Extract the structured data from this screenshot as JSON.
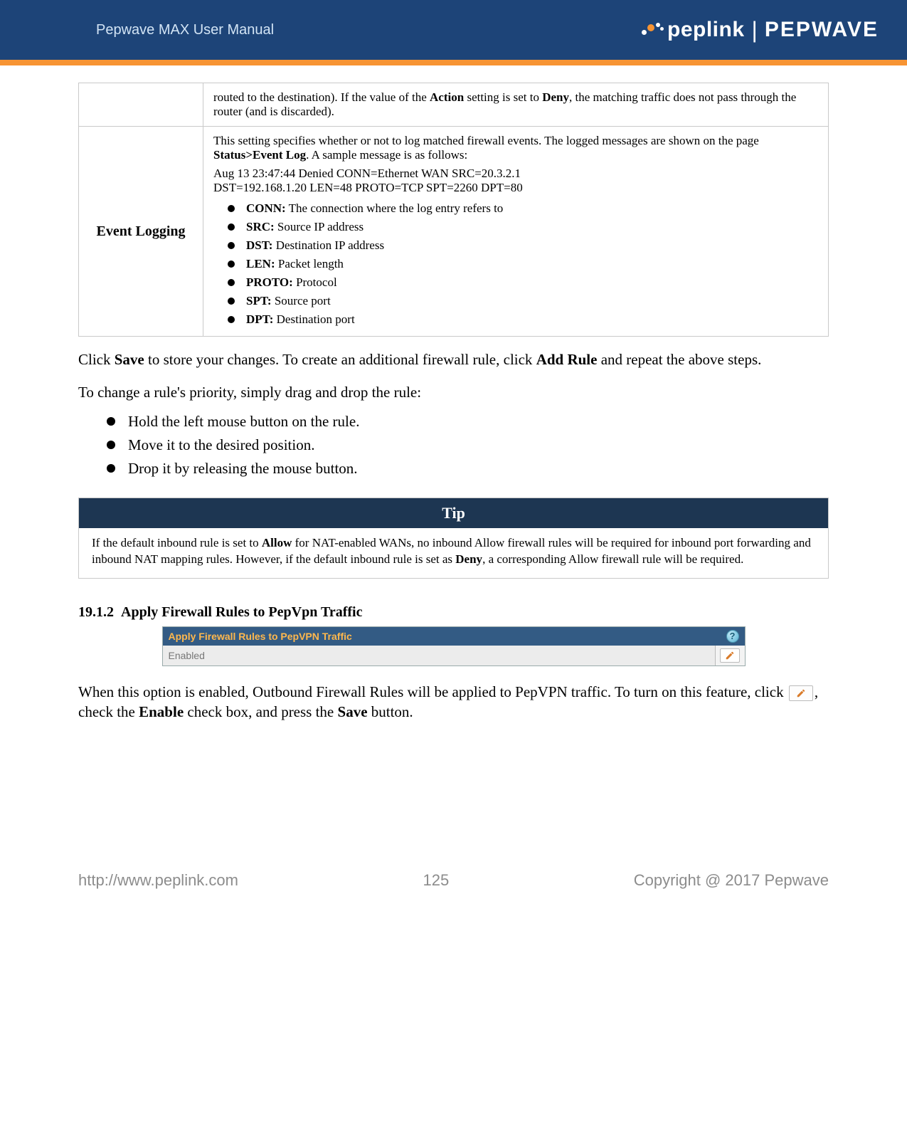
{
  "header": {
    "manual_title": "Pepwave MAX User Manual",
    "brand_left": "peplink",
    "brand_right": "PEPWAVE"
  },
  "table": {
    "row1_text_pre": "routed to the destination). If the value of the ",
    "row1_bold1": "Action",
    "row1_mid": " setting is set to ",
    "row1_bold2": "Deny",
    "row1_text_post": ", the matching traffic does not pass through the router (and is discarded).",
    "row2_label": "Event Logging",
    "row2_p1_pre": "This setting specifies whether or not to log matched firewall events. The logged messages are shown on the page ",
    "row2_p1_bold": "Status>Event Log",
    "row2_p1_post": ". A sample message is as follows:",
    "row2_p2": "Aug 13 23:47:44 Denied CONN=Ethernet WAN SRC=20.3.2.1",
    "row2_p3": "DST=192.168.1.20 LEN=48 PROTO=TCP SPT=2260 DPT=80",
    "defs": [
      {
        "term": "CONN:",
        "desc": "  The connection where the log entry refers to"
      },
      {
        "term": "SRC:",
        "desc": "  Source IP address"
      },
      {
        "term": "DST:",
        "desc": "  Destination IP address"
      },
      {
        "term": "LEN:",
        "desc": "  Packet length"
      },
      {
        "term": "PROTO:",
        "desc": "  Protocol"
      },
      {
        "term": "SPT:",
        "desc": "  Source port"
      },
      {
        "term": "DPT:",
        "desc": "  Destination port"
      }
    ]
  },
  "para1": {
    "pre": "Click ",
    "b1": "Save",
    "mid1": " to store your changes. To create an additional firewall rule, click ",
    "b2": "Add Rule",
    "post": " and repeat the above steps."
  },
  "para2": "To change a rule's priority, simply drag and drop the rule:",
  "steps": [
    "Hold the left mouse button on the rule.",
    "Move it to the desired position.",
    "Drop it by releasing the mouse button."
  ],
  "tip": {
    "title": "Tip",
    "pre": "If the default inbound rule is set to ",
    "b1": "Allow",
    "mid": " for NAT-enabled WANs, no inbound Allow firewall rules will be required for inbound port forwarding and inbound NAT mapping rules. However, if the default inbound rule is set as ",
    "b2": "Deny",
    "post": ", a corresponding Allow firewall rule will be required."
  },
  "section": {
    "num": "19.1.2",
    "title": "Apply Firewall Rules to PepVpn Traffic"
  },
  "panel": {
    "heading": "Apply Firewall Rules to PepVPN Traffic",
    "row_label": "Enabled"
  },
  "para3": {
    "pre": "When this option is enabled, Outbound Firewall Rules will be applied to PepVPN traffic. To turn on this feature, click ",
    "mid": ", check the ",
    "b1": "Enable",
    "mid2": " check box, and press the ",
    "b2": "Save",
    "post": " button."
  },
  "footer": {
    "left": "http://www.peplink.com",
    "center": "125",
    "right": "Copyright @ 2017 Pepwave"
  }
}
